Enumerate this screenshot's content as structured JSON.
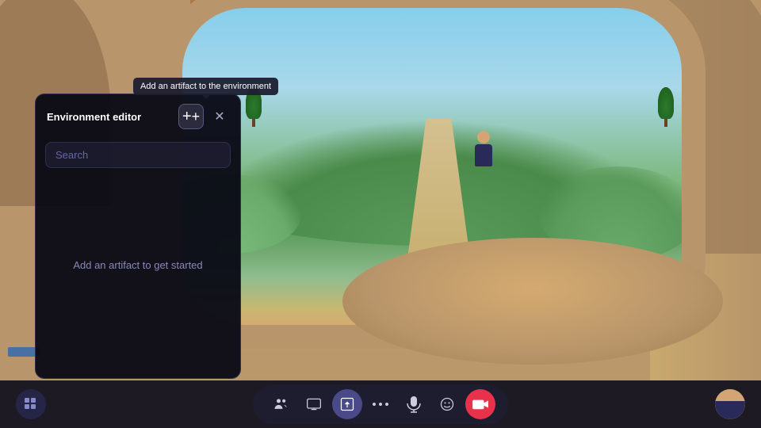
{
  "scene": {
    "background_color": "#b8956a"
  },
  "tooltip": {
    "text": "Add an artifact to the environment"
  },
  "env_panel": {
    "title": "Environment editor",
    "search_placeholder": "Search",
    "empty_message": "Add an artifact to get started",
    "add_button_label": "Add artifact",
    "close_button_label": "Close"
  },
  "toolbar": {
    "grid_button_label": "Grid menu",
    "people_button_label": "People",
    "screen_button_label": "Screen share",
    "share_button_label": "Share",
    "more_button_label": "More options",
    "mic_button_label": "Microphone",
    "emoji_button_label": "Emoji",
    "camera_button_label": "Camera",
    "avatar_button_label": "Avatar"
  }
}
